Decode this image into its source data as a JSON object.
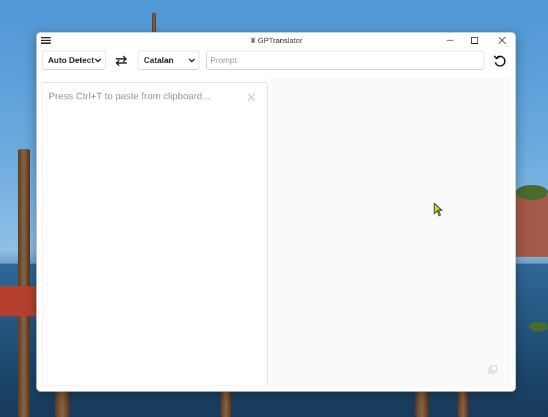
{
  "window": {
    "title": "GPTranslator",
    "controls": [
      "minimize",
      "maximize",
      "close"
    ]
  },
  "toolbar": {
    "source_language": "Auto Detect",
    "target_language": "Catalan",
    "prompt_placeholder": "Prompt",
    "prompt_value": ""
  },
  "input_pane": {
    "placeholder": "Press Ctrl+T to paste from clipboard...",
    "text": ""
  },
  "output_pane": {
    "text": ""
  },
  "icons": {
    "menu": "hamburger-icon",
    "swap": "swap-arrows-icon",
    "refresh": "refresh-icon",
    "clear": "close-icon",
    "copy": "copy-icon",
    "app": "app-logo-icon"
  },
  "colors": {
    "window_bg": "#ffffff",
    "border": "#d2d4d7",
    "placeholder_text": "#8f8f8f",
    "cursor": "#c6e02a"
  }
}
